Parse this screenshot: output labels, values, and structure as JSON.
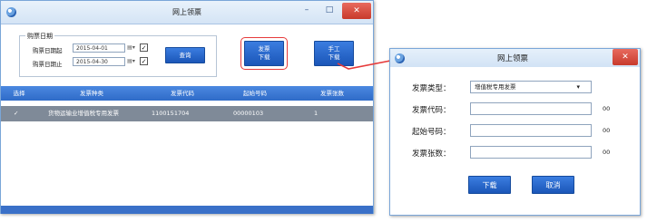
{
  "main_window": {
    "title": "网上领票",
    "minimize": "–",
    "maximize": "□",
    "close": "✕",
    "date_group": {
      "legend": "购票日期",
      "start_label": "购票日期起",
      "start_value": "2015-04-01",
      "end_label": "购票日期止",
      "end_value": "2015-04-30",
      "calendar_glyph": "▤▾",
      "check_glyph": "✓"
    },
    "query_button": "查询",
    "download_button": [
      "发票",
      "下载"
    ],
    "manual_download_button": [
      "手工",
      "下载"
    ],
    "table": {
      "columns": [
        "选择",
        "发票种类",
        "发票代码",
        "起始号码",
        "发票张数"
      ],
      "rows": [
        {
          "selected": "✓",
          "type": "货物运输业增值税专用发票",
          "code": "1100151704",
          "start": "00000103",
          "count": "1"
        }
      ]
    }
  },
  "dialog": {
    "title": "网上领票",
    "close": "✕",
    "type_label": "发票类型：",
    "type_value": "增值税专用发票",
    "dropdown_glyph": "▾",
    "code_label": "发票代码：",
    "code_value": "",
    "start_label": "起始号码：",
    "start_value": "",
    "count_label": "发票张数：",
    "count_value": "",
    "unit_suffix": "00",
    "download_button": "下载",
    "cancel_button": "取消"
  },
  "colors": {
    "accent": "#2f6bc8",
    "highlight": "#e63a3a",
    "selected_row": "#7f8a98"
  }
}
